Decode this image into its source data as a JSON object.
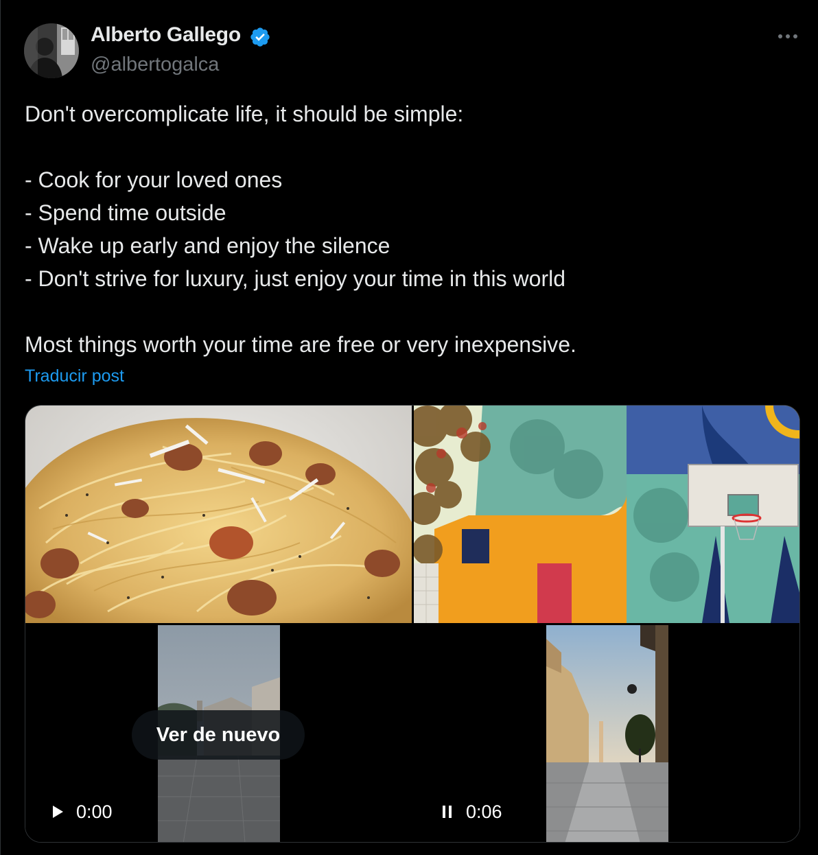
{
  "author": {
    "name": "Alberto Gallego",
    "handle": "@albertogalca",
    "verified": true,
    "avatar_icon": "avatar-photo"
  },
  "post": {
    "lines": [
      "Don't overcomplicate life, it should be simple:",
      "",
      "- Cook for your loved ones",
      "- Spend time outside",
      "- Wake up early and enjoy the silence",
      "- Don't strive for luxury, just enjoy your time in this world",
      "",
      "Most things worth your time are free or very inexpensive."
    ],
    "translate_label": "Traducir post"
  },
  "media": {
    "video1": {
      "replay_label": "Ver de nuevo",
      "time": "0:00",
      "state_icon": "play-icon"
    },
    "video2": {
      "time": "0:06",
      "state_icon": "pause-icon"
    }
  },
  "colors": {
    "background": "#000000",
    "text": "#e7e9ea",
    "muted": "#71767b",
    "link": "#1d9bf0",
    "verified": "#1d9bf0"
  }
}
